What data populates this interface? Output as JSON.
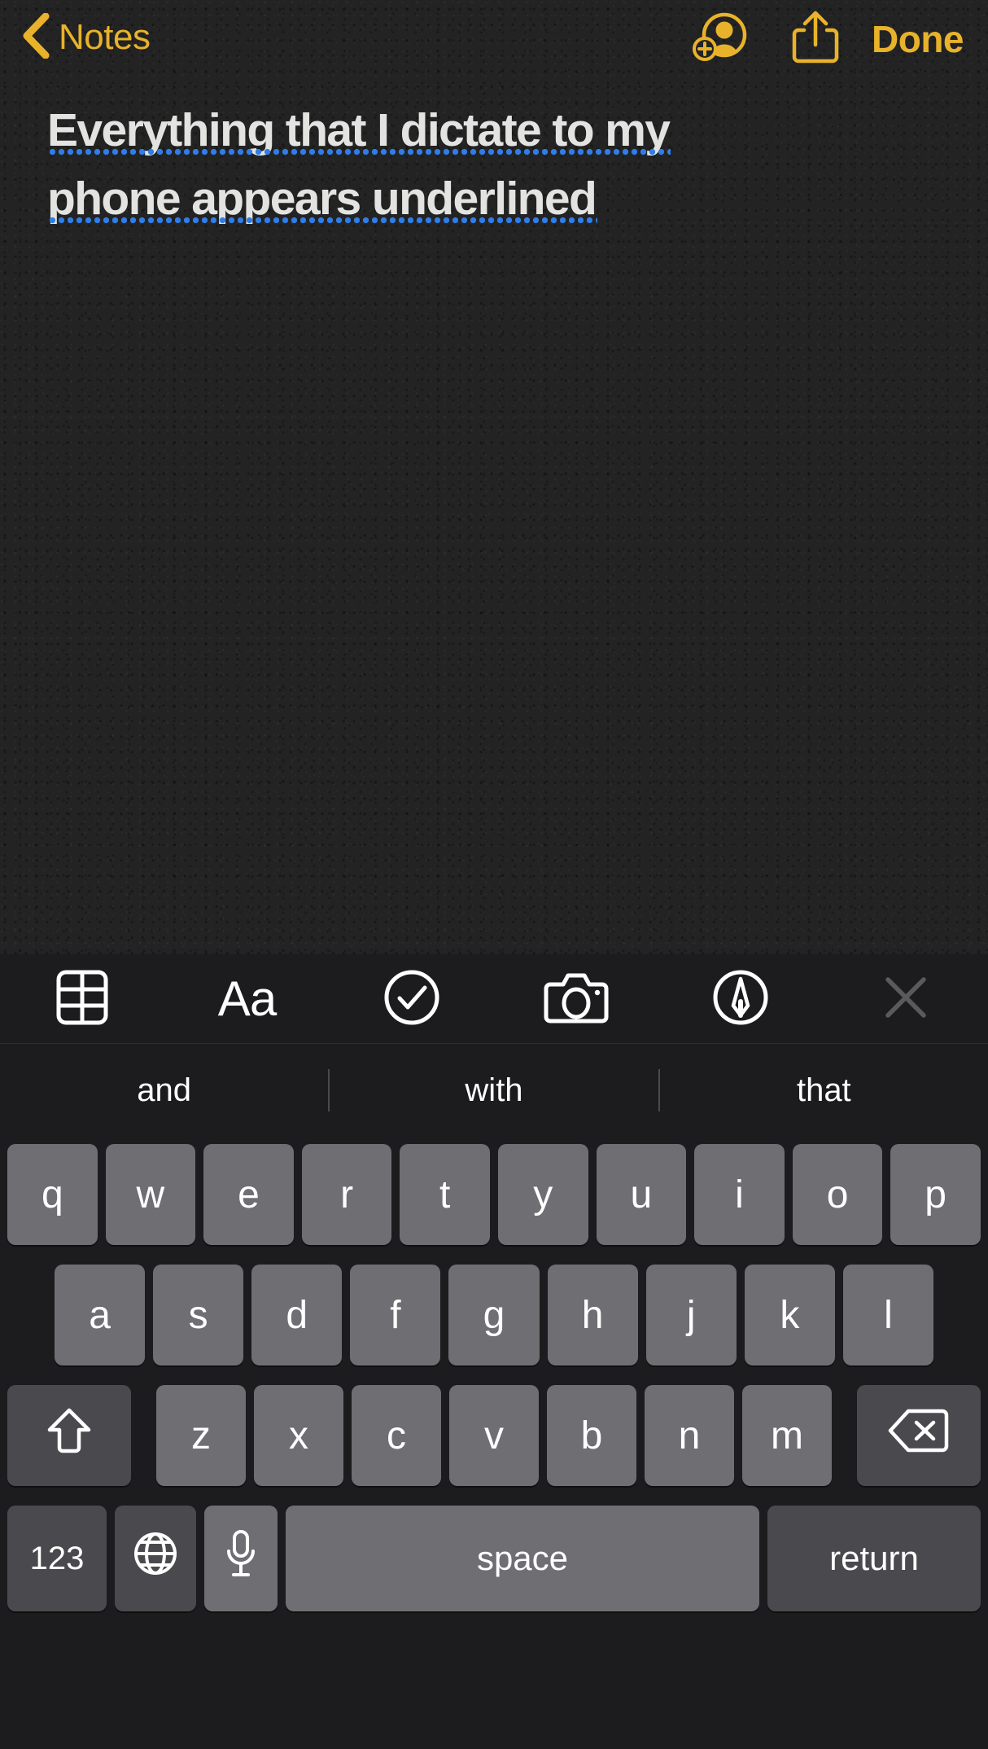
{
  "app": {
    "name": "Notes",
    "theme": "dark"
  },
  "colors": {
    "accent_yellow": "#e8b32a",
    "dictation_underline_blue": "#2f7de8",
    "note_background": "#232324",
    "keyboard_background": "#1c1c1e",
    "key_light": "#6e6e73",
    "key_dark": "#4a4a4e",
    "toolbar_icon": "#ffffff",
    "toolbar_icon_dim": "#5a5a5c",
    "note_text": "#e3e3e1"
  },
  "navbar": {
    "back_label": "Notes",
    "back_icon": "chevron-left-icon",
    "collaborate_icon": "add-person-icon",
    "share_icon": "share-icon",
    "done_label": "Done"
  },
  "note": {
    "lines": [
      "Everything that I dictate to my",
      "phone appears underlined"
    ],
    "full_text": "Everything that I dictate to my phone appears underlined",
    "style": "bold-title",
    "dictation_underline": true
  },
  "note_toolbar": {
    "items": [
      {
        "icon": "table-icon",
        "label": "Table",
        "dim": false
      },
      {
        "icon": "format-aa-icon",
        "label": "Aa",
        "dim": false
      },
      {
        "icon": "checklist-icon",
        "label": "Checklist",
        "dim": false
      },
      {
        "icon": "camera-icon",
        "label": "Camera",
        "dim": false
      },
      {
        "icon": "markup-pen-icon",
        "label": "Markup",
        "dim": false
      },
      {
        "icon": "close-x-icon",
        "label": "Close",
        "dim": true
      }
    ]
  },
  "keyboard": {
    "suggestions": [
      "and",
      "with",
      "that"
    ],
    "rows": {
      "top": [
        "q",
        "w",
        "e",
        "r",
        "t",
        "y",
        "u",
        "i",
        "o",
        "p"
      ],
      "home": [
        "a",
        "s",
        "d",
        "f",
        "g",
        "h",
        "j",
        "k",
        "l"
      ],
      "bottom": [
        "z",
        "x",
        "c",
        "v",
        "b",
        "n",
        "m"
      ]
    },
    "shift_icon": "shift-up-arrow-icon",
    "backspace_icon": "backspace-delete-icon",
    "numbers_label": "123",
    "globe_icon": "globe-icon",
    "mic_icon": "microphone-icon",
    "space_label": "space",
    "return_label": "return",
    "case": "lowercase"
  }
}
